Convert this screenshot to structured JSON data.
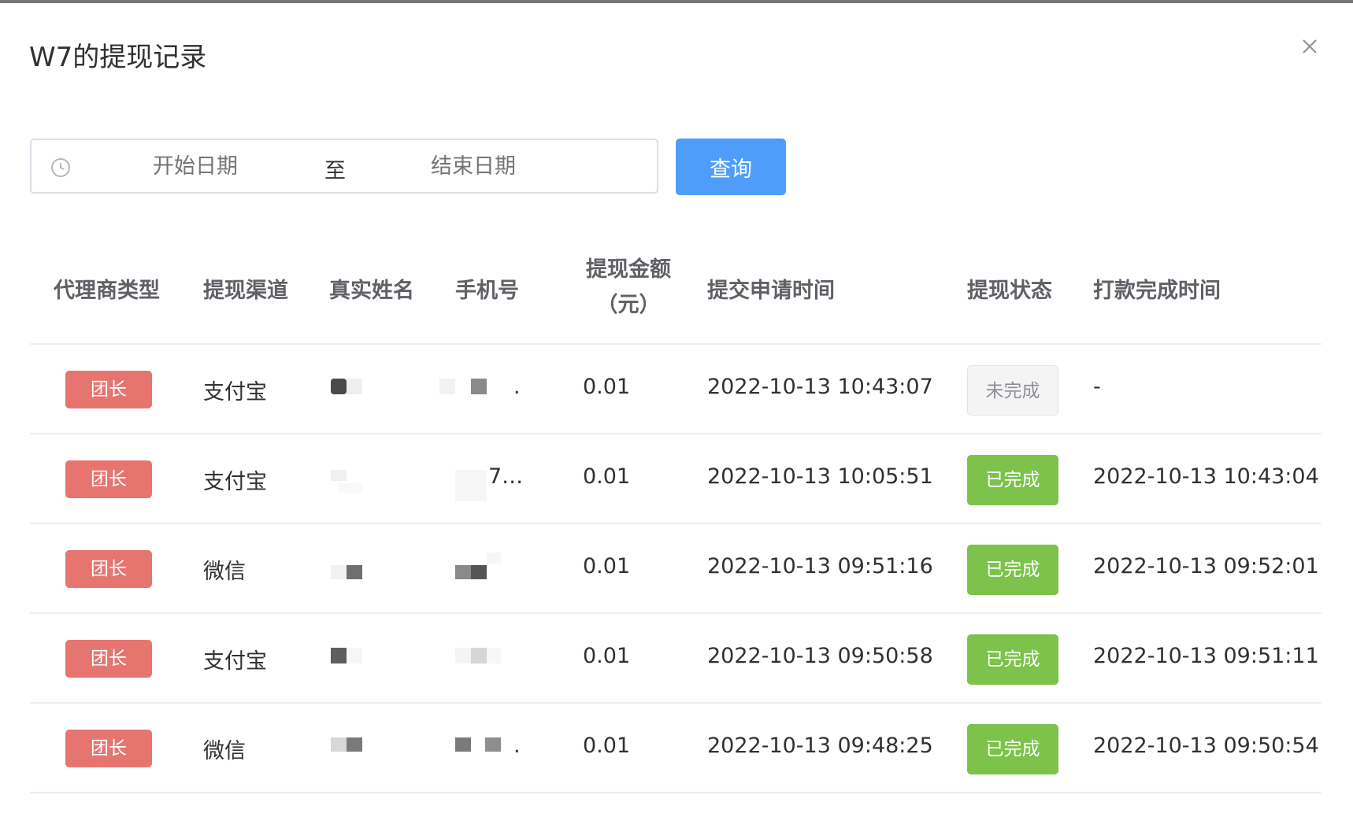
{
  "dialog": {
    "title": "W7的提现记录",
    "close_icon": "close-icon"
  },
  "filter": {
    "start_placeholder": "开始日期",
    "separator": "至",
    "end_placeholder": "结束日期",
    "clock_icon": "clock-icon",
    "query_label": "查询",
    "accent": "#4f9dfb"
  },
  "table": {
    "headers": {
      "type": "代理商类型",
      "channel": "提现渠道",
      "name": "真实姓名",
      "phone": "手机号",
      "amount_line1": "提现金额",
      "amount_line2": "（元）",
      "submit_time": "提交申请时间",
      "status": "提现状态",
      "paid_time": "打款完成时间"
    },
    "rows": [
      {
        "type": "团长",
        "channel": "支付宝",
        "phone_suffix": ".",
        "amount": "0.01",
        "submit_time": "2022-10-13 10:43:07",
        "status": "未完成",
        "paid_time": "-"
      },
      {
        "type": "团长",
        "channel": "支付宝",
        "phone_suffix": "7…",
        "amount": "0.01",
        "submit_time": "2022-10-13 10:05:51",
        "status": "已完成",
        "paid_time": "2022-10-13 10:43:04"
      },
      {
        "type": "团长",
        "channel": "微信",
        "phone_suffix": "",
        "amount": "0.01",
        "submit_time": "2022-10-13 09:51:16",
        "status": "已完成",
        "paid_time": "2022-10-13 09:52:01"
      },
      {
        "type": "团长",
        "channel": "支付宝",
        "phone_suffix": "",
        "amount": "0.01",
        "submit_time": "2022-10-13 09:50:58",
        "status": "已完成",
        "paid_time": "2022-10-13 09:51:11"
      },
      {
        "type": "团长",
        "channel": "微信",
        "phone_suffix": ".",
        "amount": "0.01",
        "submit_time": "2022-10-13 09:48:25",
        "status": "已完成",
        "paid_time": "2022-10-13 09:50:54"
      }
    ],
    "colors": {
      "type_tag": "#e67570",
      "status_done": "#7cc24b",
      "status_pending": "#f4f4f5"
    }
  }
}
